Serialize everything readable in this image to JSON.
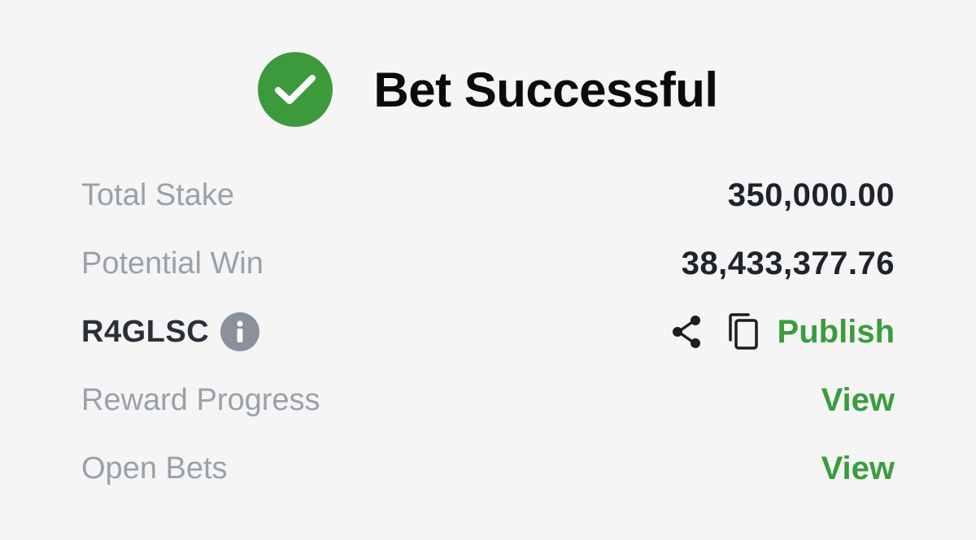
{
  "header": {
    "title": "Bet Successful",
    "status_icon": "check-circle-icon",
    "status_color": "#3c9a3d"
  },
  "summary": {
    "total_stake_label": "Total Stake",
    "total_stake_value": "350,000.00",
    "potential_win_label": "Potential Win",
    "potential_win_value": "38,433,377.76"
  },
  "booking": {
    "code": "R4GLSC",
    "info_icon": "info-icon",
    "share_icon": "share-icon",
    "copy_icon": "copy-icon",
    "publish_label": "Publish"
  },
  "links": {
    "reward_progress_label": "Reward Progress",
    "reward_progress_action": "View",
    "open_bets_label": "Open Bets",
    "open_bets_action": "View"
  },
  "colors": {
    "accent": "#3b9c3e",
    "label": "#9aa1ab",
    "value": "#1f232b",
    "background": "#f5f5f5"
  }
}
